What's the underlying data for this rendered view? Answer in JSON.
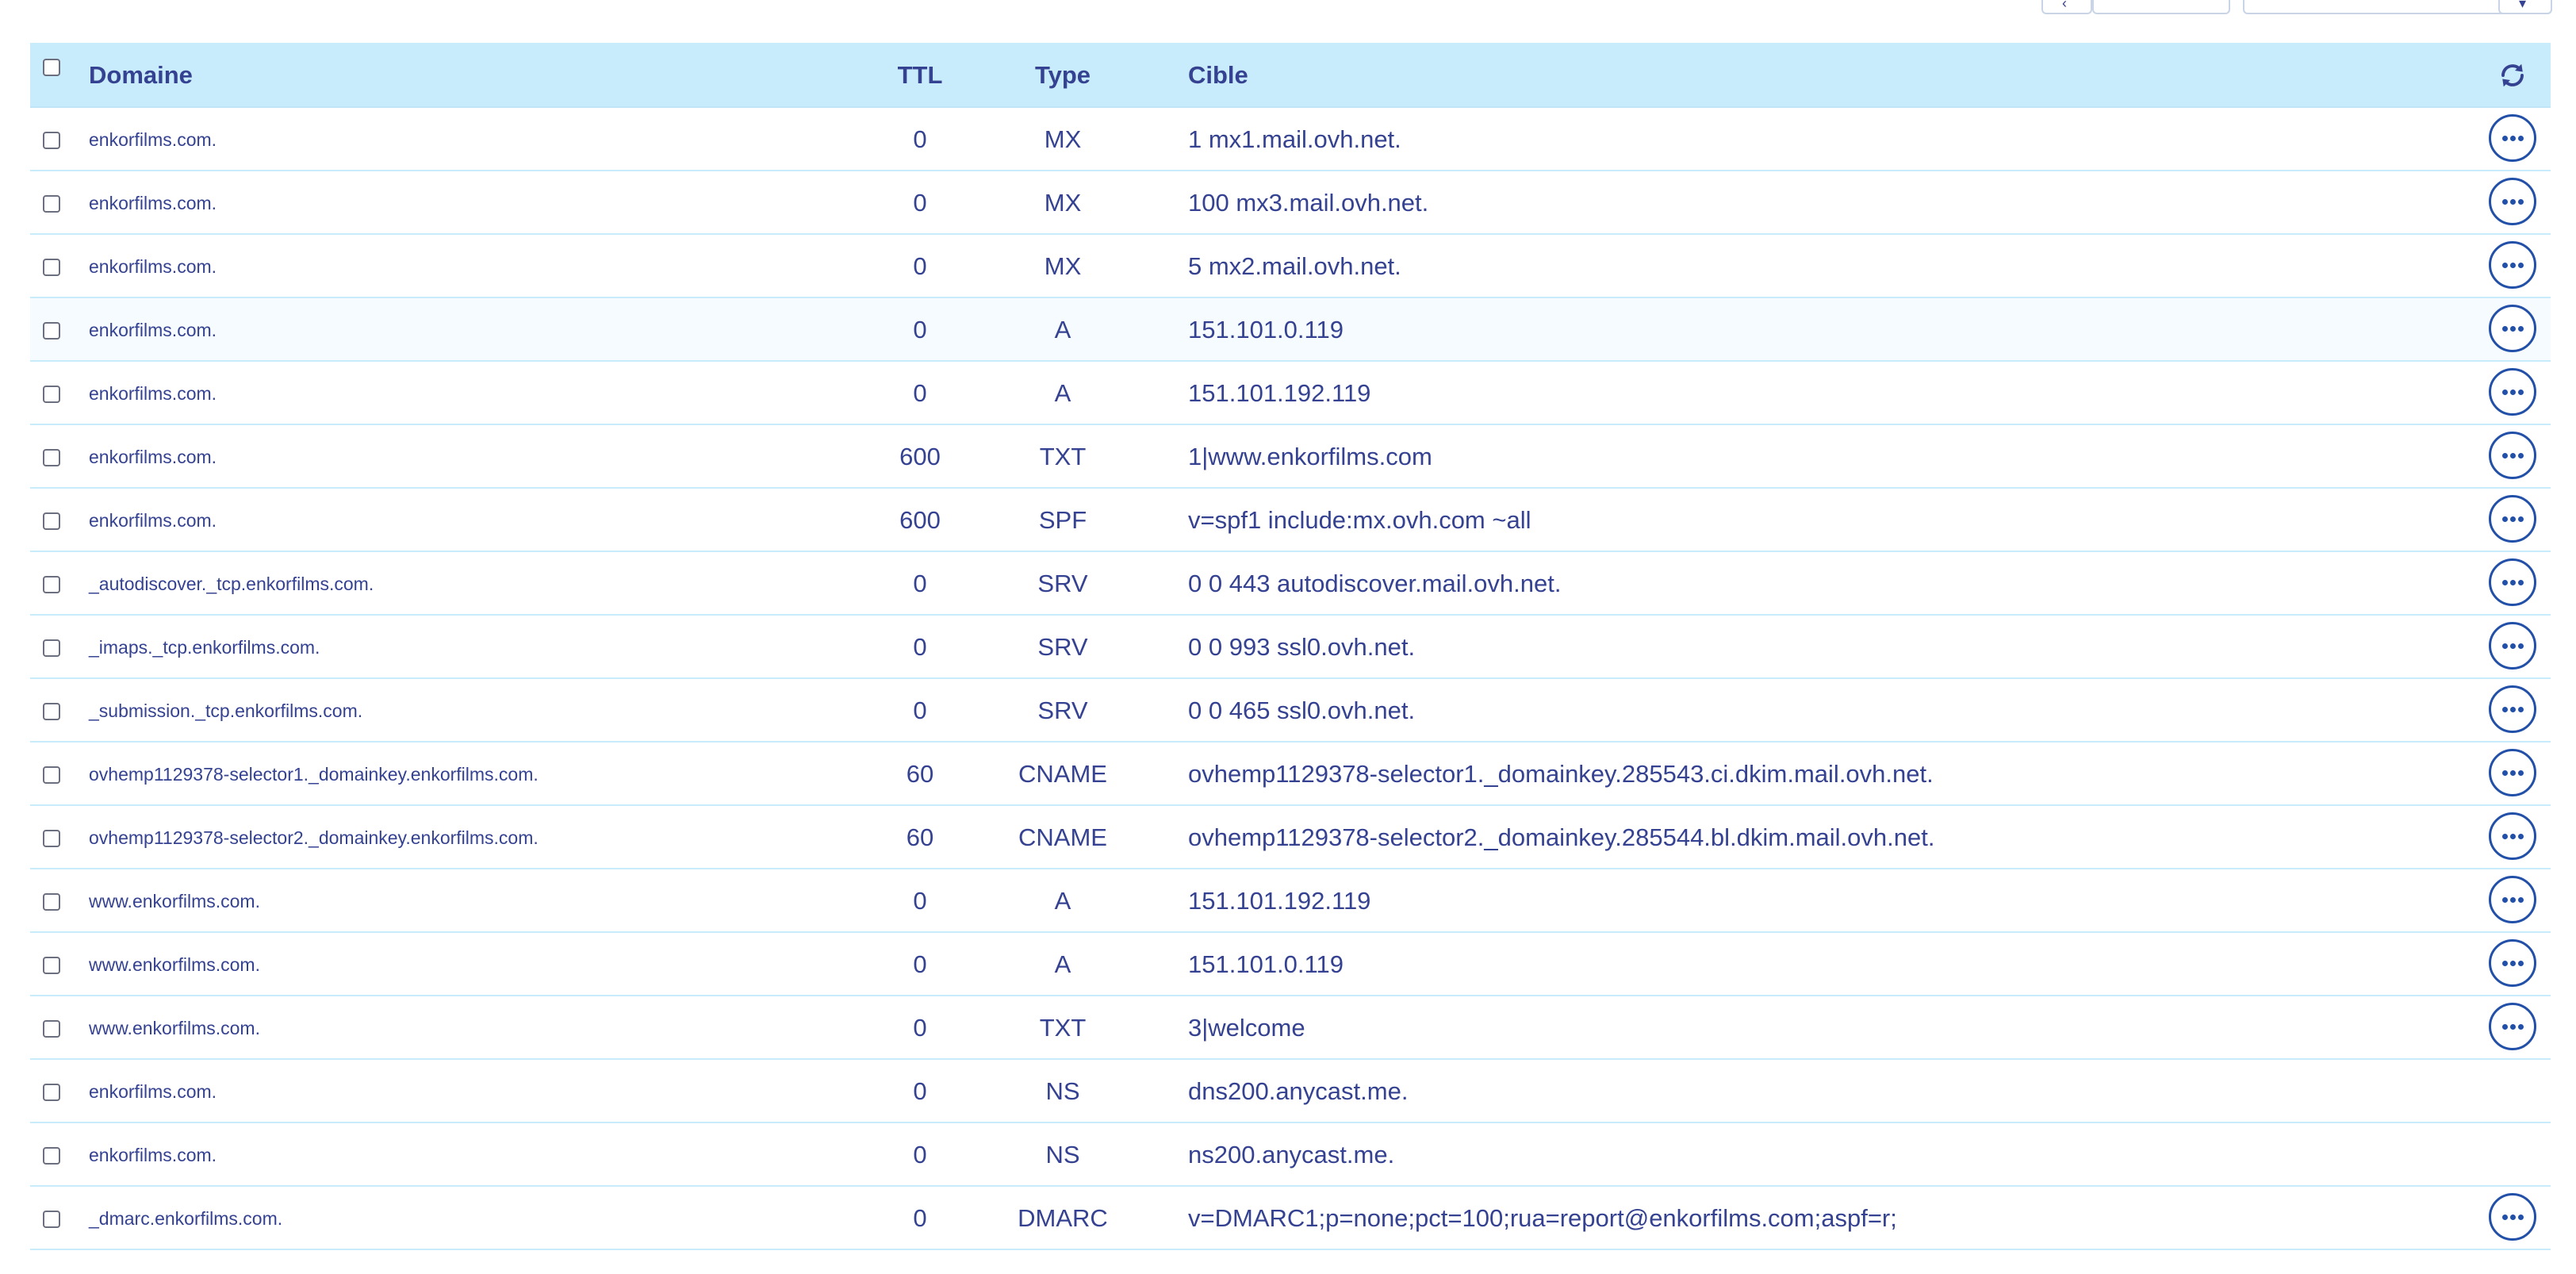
{
  "columns": {
    "domain": "Domaine",
    "ttl": "TTL",
    "type": "Type",
    "target": "Cible"
  },
  "icons": {
    "refresh": "refresh-icon",
    "row_actions": "more-horizontal-icon",
    "pager_prev": "chevron-left-icon",
    "filter_caret": "chevron-down-icon"
  },
  "colors": {
    "header_bg": "#c8ecfb",
    "text": "#354291",
    "accent": "#2250a8",
    "row_border": "#c8ecfb"
  },
  "rows": [
    {
      "domain": "enkorfilms.com.",
      "ttl": "0",
      "type": "MX",
      "target": "1 mx1.mail.ovh.net.",
      "actions": true
    },
    {
      "domain": "enkorfilms.com.",
      "ttl": "0",
      "type": "MX",
      "target": "100 mx3.mail.ovh.net.",
      "actions": true
    },
    {
      "domain": "enkorfilms.com.",
      "ttl": "0",
      "type": "MX",
      "target": "5 mx2.mail.ovh.net.",
      "actions": true
    },
    {
      "domain": "enkorfilms.com.",
      "ttl": "0",
      "type": "A",
      "target": "151.101.0.119",
      "actions": true,
      "highlight": true
    },
    {
      "domain": "enkorfilms.com.",
      "ttl": "0",
      "type": "A",
      "target": "151.101.192.119",
      "actions": true
    },
    {
      "domain": "enkorfilms.com.",
      "ttl": "600",
      "type": "TXT",
      "target": "1|www.enkorfilms.com",
      "actions": true
    },
    {
      "domain": "enkorfilms.com.",
      "ttl": "600",
      "type": "SPF",
      "target": "v=spf1 include:mx.ovh.com ~all",
      "actions": true
    },
    {
      "domain": "_autodiscover._tcp.enkorfilms.com.",
      "ttl": "0",
      "type": "SRV",
      "target": "0 0 443 autodiscover.mail.ovh.net.",
      "actions": true
    },
    {
      "domain": "_imaps._tcp.enkorfilms.com.",
      "ttl": "0",
      "type": "SRV",
      "target": "0 0 993 ssl0.ovh.net.",
      "actions": true
    },
    {
      "domain": "_submission._tcp.enkorfilms.com.",
      "ttl": "0",
      "type": "SRV",
      "target": "0 0 465 ssl0.ovh.net.",
      "actions": true
    },
    {
      "domain": "ovhemp1129378-selector1._domainkey.enkorfilms.com.",
      "ttl": "60",
      "type": "CNAME",
      "target": "ovhemp1129378-selector1._domainkey.285543.ci.dkim.mail.ovh.net.",
      "actions": true
    },
    {
      "domain": "ovhemp1129378-selector2._domainkey.enkorfilms.com.",
      "ttl": "60",
      "type": "CNAME",
      "target": "ovhemp1129378-selector2._domainkey.285544.bl.dkim.mail.ovh.net.",
      "actions": true
    },
    {
      "domain": "www.enkorfilms.com.",
      "ttl": "0",
      "type": "A",
      "target": "151.101.192.119",
      "actions": true
    },
    {
      "domain": "www.enkorfilms.com.",
      "ttl": "0",
      "type": "A",
      "target": "151.101.0.119",
      "actions": true
    },
    {
      "domain": "www.enkorfilms.com.",
      "ttl": "0",
      "type": "TXT",
      "target": "3|welcome",
      "actions": true
    },
    {
      "domain": "enkorfilms.com.",
      "ttl": "0",
      "type": "NS",
      "target": "dns200.anycast.me.",
      "actions": false
    },
    {
      "domain": "enkorfilms.com.",
      "ttl": "0",
      "type": "NS",
      "target": "ns200.anycast.me.",
      "actions": false
    },
    {
      "domain": "_dmarc.enkorfilms.com.",
      "ttl": "0",
      "type": "DMARC",
      "target": "v=DMARC1;p=none;pct=100;rua=report@enkorfilms.com;aspf=r;",
      "actions": true
    }
  ]
}
